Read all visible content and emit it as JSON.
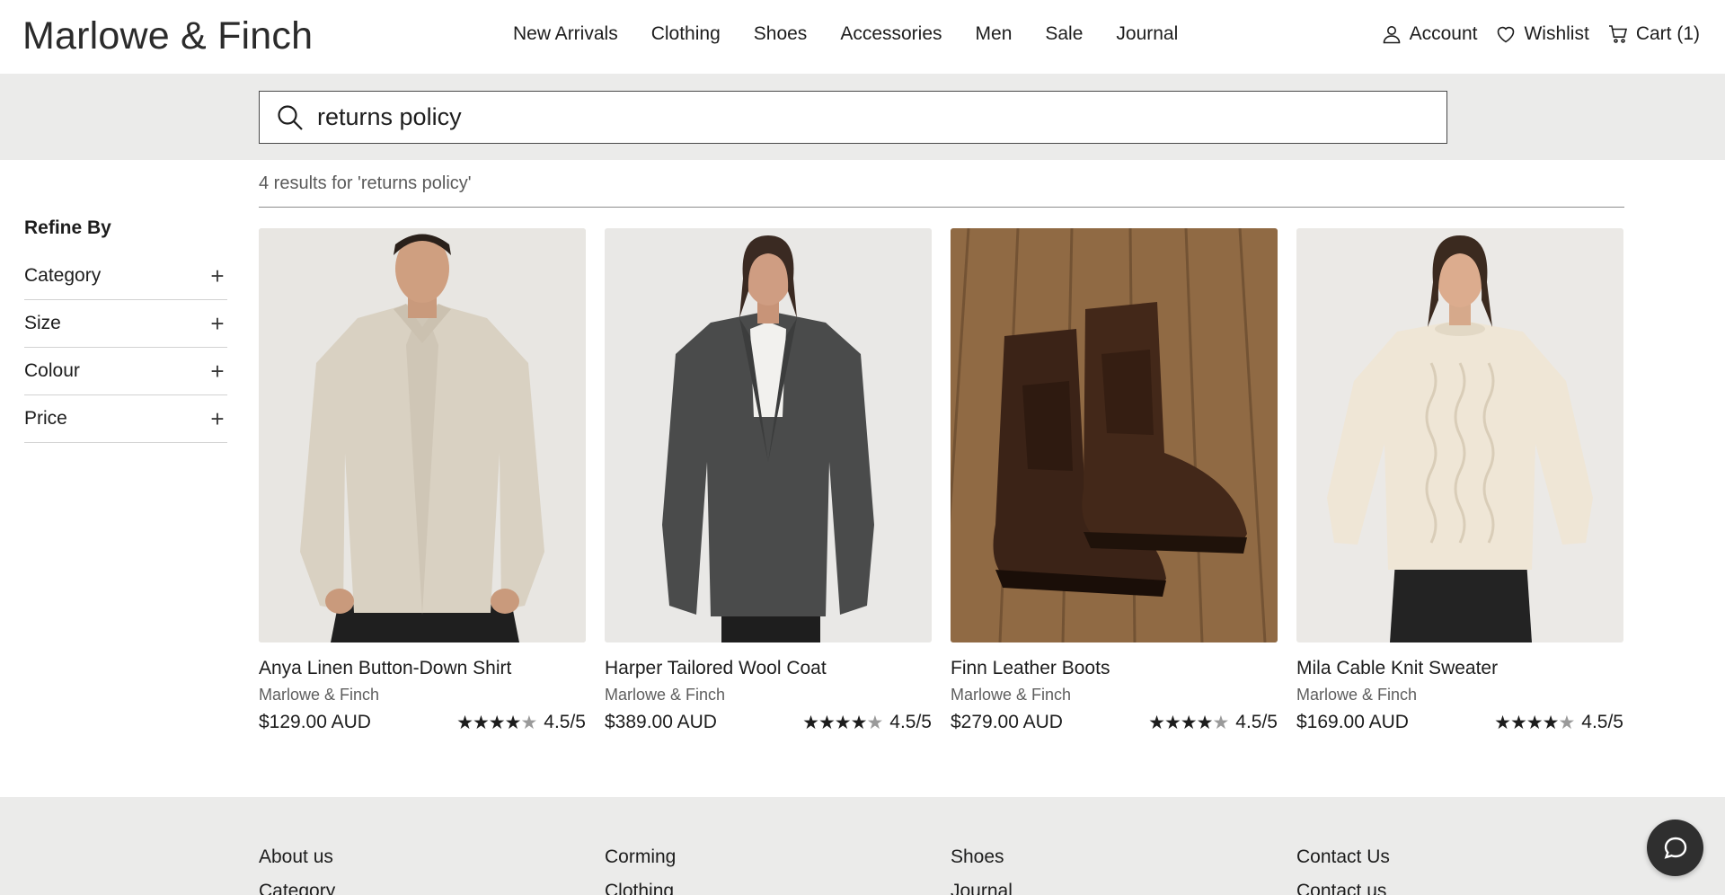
{
  "header": {
    "logo": "Marlowe & Finch",
    "nav": [
      "New Arrivals",
      "Clothing",
      "Shoes",
      "Accessories",
      "Men",
      "Sale",
      "Journal"
    ],
    "account_label": "Account",
    "wishlist_label": "Wishlist",
    "cart_label": "Cart (1)"
  },
  "search": {
    "value": "returns policy",
    "icon": "search-icon"
  },
  "results": {
    "count_text": "4 results for 'returns policy'"
  },
  "sidebar": {
    "title": "Refine By",
    "filters": [
      {
        "label": "Category"
      },
      {
        "label": "Size"
      },
      {
        "label": "Colour"
      },
      {
        "label": "Price"
      }
    ]
  },
  "products": [
    {
      "name": "Anya Linen Button-Down Shirt",
      "brand": "Marlowe & Finch",
      "price": "$129.00 AUD",
      "rating": "4.5/5",
      "stars": 4.5
    },
    {
      "name": "Harper Tailored Wool Coat",
      "brand": "Marlowe & Finch",
      "price": "$389.00 AUD",
      "rating": "4.5/5",
      "stars": 4.5
    },
    {
      "name": "Finn Leather Boots",
      "brand": "Marlowe & Finch",
      "price": "$279.00 AUD",
      "rating": "4.5/5",
      "stars": 4.5
    },
    {
      "name": "Mila Cable Knit Sweater",
      "brand": "Marlowe & Finch",
      "price": "$169.00 AUD",
      "rating": "4.5/5",
      "stars": 4.5
    }
  ],
  "footer": {
    "columns": [
      {
        "title": "About us",
        "sub": "Category"
      },
      {
        "title": "Corming",
        "sub": "Clothing"
      },
      {
        "title": "Shoes",
        "sub": "Journal"
      },
      {
        "title": "Contact Us",
        "sub": "Contact us"
      }
    ]
  },
  "colors": {
    "band_bg": "#ebebea",
    "text": "#1d1d1d",
    "chat_button": "#2f2f2f"
  }
}
